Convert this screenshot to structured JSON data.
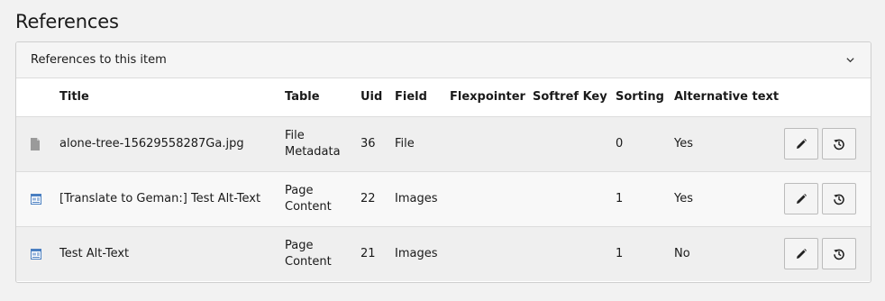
{
  "page": {
    "title": "References"
  },
  "panel": {
    "header": "References to this item"
  },
  "table": {
    "columns": [
      "Title",
      "Table",
      "Uid",
      "Field",
      "Flexpointer",
      "Softref Key",
      "Sorting",
      "Alternative text"
    ],
    "rows": [
      {
        "icon": "file-icon",
        "title": "alone-tree-15629558287Ga.jpg",
        "table_line1": "File",
        "table_line2": "Metadata",
        "uid": "36",
        "field": "File",
        "flexpointer": "",
        "softref_key": "",
        "sorting": "0",
        "alt_text": "Yes"
      },
      {
        "icon": "page-content-icon",
        "title": "[Translate to Geman:] Test Alt-Text",
        "table_line1": "Page",
        "table_line2": "Content",
        "uid": "22",
        "field": "Images",
        "flexpointer": "",
        "softref_key": "",
        "sorting": "1",
        "alt_text": "Yes"
      },
      {
        "icon": "page-content-icon",
        "title": "Test Alt-Text",
        "table_line1": "Page",
        "table_line2": "Content",
        "uid": "21",
        "field": "Images",
        "flexpointer": "",
        "softref_key": "",
        "sorting": "1",
        "alt_text": "No"
      }
    ]
  },
  "colors": {
    "page_bg": "#f2f2f2",
    "panel_border": "#cfcfcf",
    "row_odd": "#efefef",
    "row_even": "#f8f8f8",
    "page_icon_blue": "#4a7fc1"
  }
}
